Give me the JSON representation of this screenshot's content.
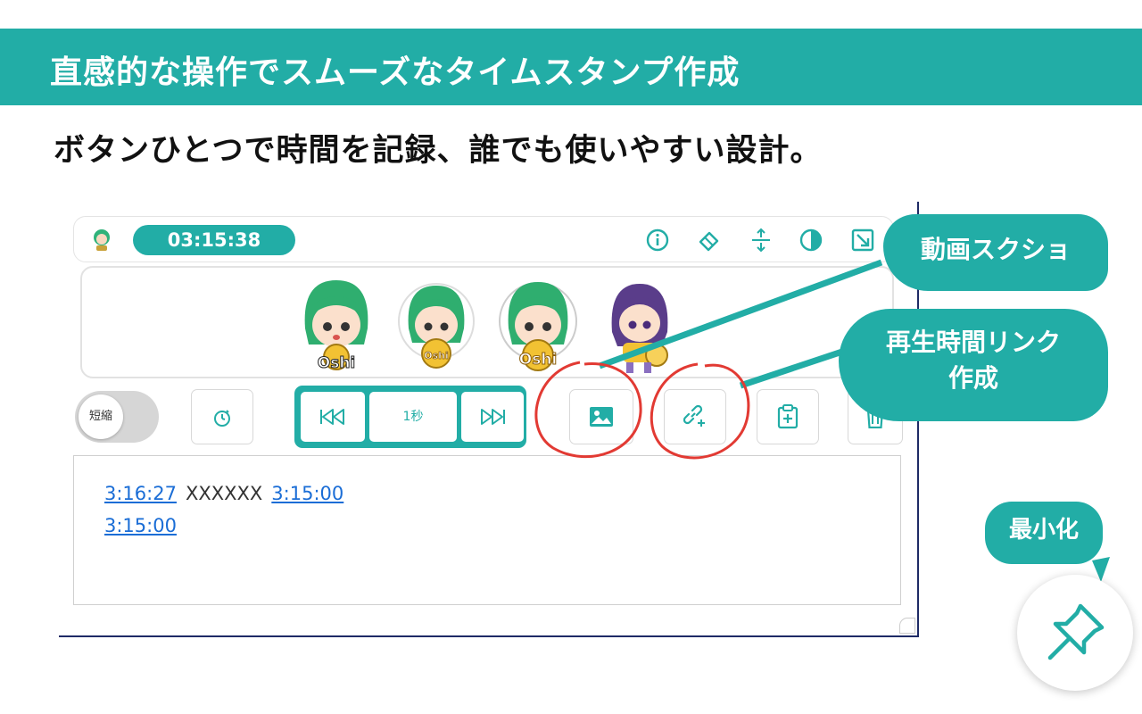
{
  "banner": {
    "title": "直感的な操作でスムーズなタイムスタンプ作成"
  },
  "subtitle": "ボタンひとつで時間を記録、誰でも使いやすい設計。",
  "toolbar": {
    "timer": "03:15:38",
    "icons": [
      "info-icon",
      "eraser-icon",
      "resize-vertical-icon",
      "contrast-icon",
      "collapse-window-icon"
    ]
  },
  "characters": [
    "oshi-girl-green-1",
    "oshi-girl-green-2",
    "oshi-girl-green-3",
    "oshi-girl-purple"
  ],
  "controls": {
    "toggle_label": "短縮",
    "seek_step": "1秒",
    "buttons": [
      "stopwatch-icon",
      "skip-back-icon",
      "skip-forward-icon",
      "screenshot-icon",
      "link-icon",
      "clipboard-add-icon",
      "trash-icon"
    ]
  },
  "log": {
    "lines": [
      {
        "link1": "3:16:27",
        "text": "XXXXXX",
        "link2": "3:15:00"
      },
      {
        "link1": "3:15:00"
      }
    ]
  },
  "callouts": {
    "screenshot": "動画スクショ",
    "link_line1": "再生時間リンク",
    "link_line2": "作成",
    "minimize": "最小化"
  },
  "colors": {
    "accent": "#22ada6",
    "highlight_circle": "#e23a33",
    "link": "#1a6dd6",
    "window_border": "#1e2b66"
  }
}
